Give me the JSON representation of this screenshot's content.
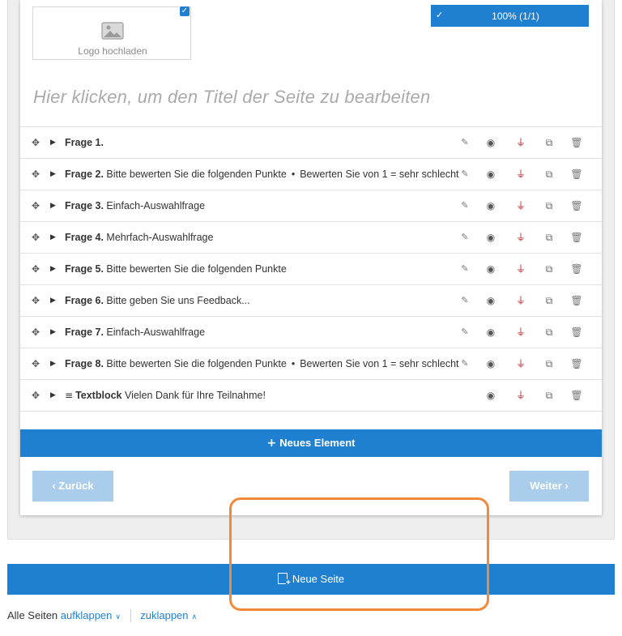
{
  "logo": {
    "label": "Logo hochladen",
    "icon": "image-icon",
    "checked": true
  },
  "progress": {
    "text": "100% (1/1)",
    "check": "✓"
  },
  "page": {
    "title_placeholder": "Hier klicken, um den Titel der Seite zu bearbeiten"
  },
  "questions": [
    {
      "label": "Frage 1.",
      "text": "",
      "sub": ""
    },
    {
      "label": "Frage 2.",
      "text": "Bitte bewerten Sie die folgenden Punkte",
      "sub": "Bewerten Sie von 1 = sehr schlecht"
    },
    {
      "label": "Frage 3.",
      "text": "Einfach-Auswahlfrage",
      "sub": ""
    },
    {
      "label": "Frage 4.",
      "text": "Mehrfach-Auswahlfrage",
      "sub": ""
    },
    {
      "label": "Frage 5.",
      "text": "Bitte bewerten Sie die folgenden Punkte",
      "sub": ""
    },
    {
      "label": "Frage 6.",
      "text": "Bitte geben Sie uns Feedback...",
      "sub": ""
    },
    {
      "label": "Frage 7.",
      "text": "Einfach-Auswahlfrage",
      "sub": ""
    },
    {
      "label": "Frage 8.",
      "text": "Bitte bewerten Sie die folgenden Punkte",
      "sub": "Bewerten Sie von 1 = sehr schlecht"
    }
  ],
  "textblock": {
    "label": "Textblock",
    "text": "Vielen Dank für Ihre Teilnahme!"
  },
  "buttons": {
    "new_element": "Neues Element",
    "back": "‹ Zurück",
    "next": "Weiter ›",
    "new_page": "Neue Seite"
  },
  "footer": {
    "all_pages": "Alle Seiten",
    "expand": "aufklappen",
    "collapse": "zuklappen"
  },
  "colors": {
    "primary": "#1f7fd0",
    "primary_light": "#a9cdeb",
    "pin": "#b21e1e",
    "annotation": "#f08a3a"
  }
}
